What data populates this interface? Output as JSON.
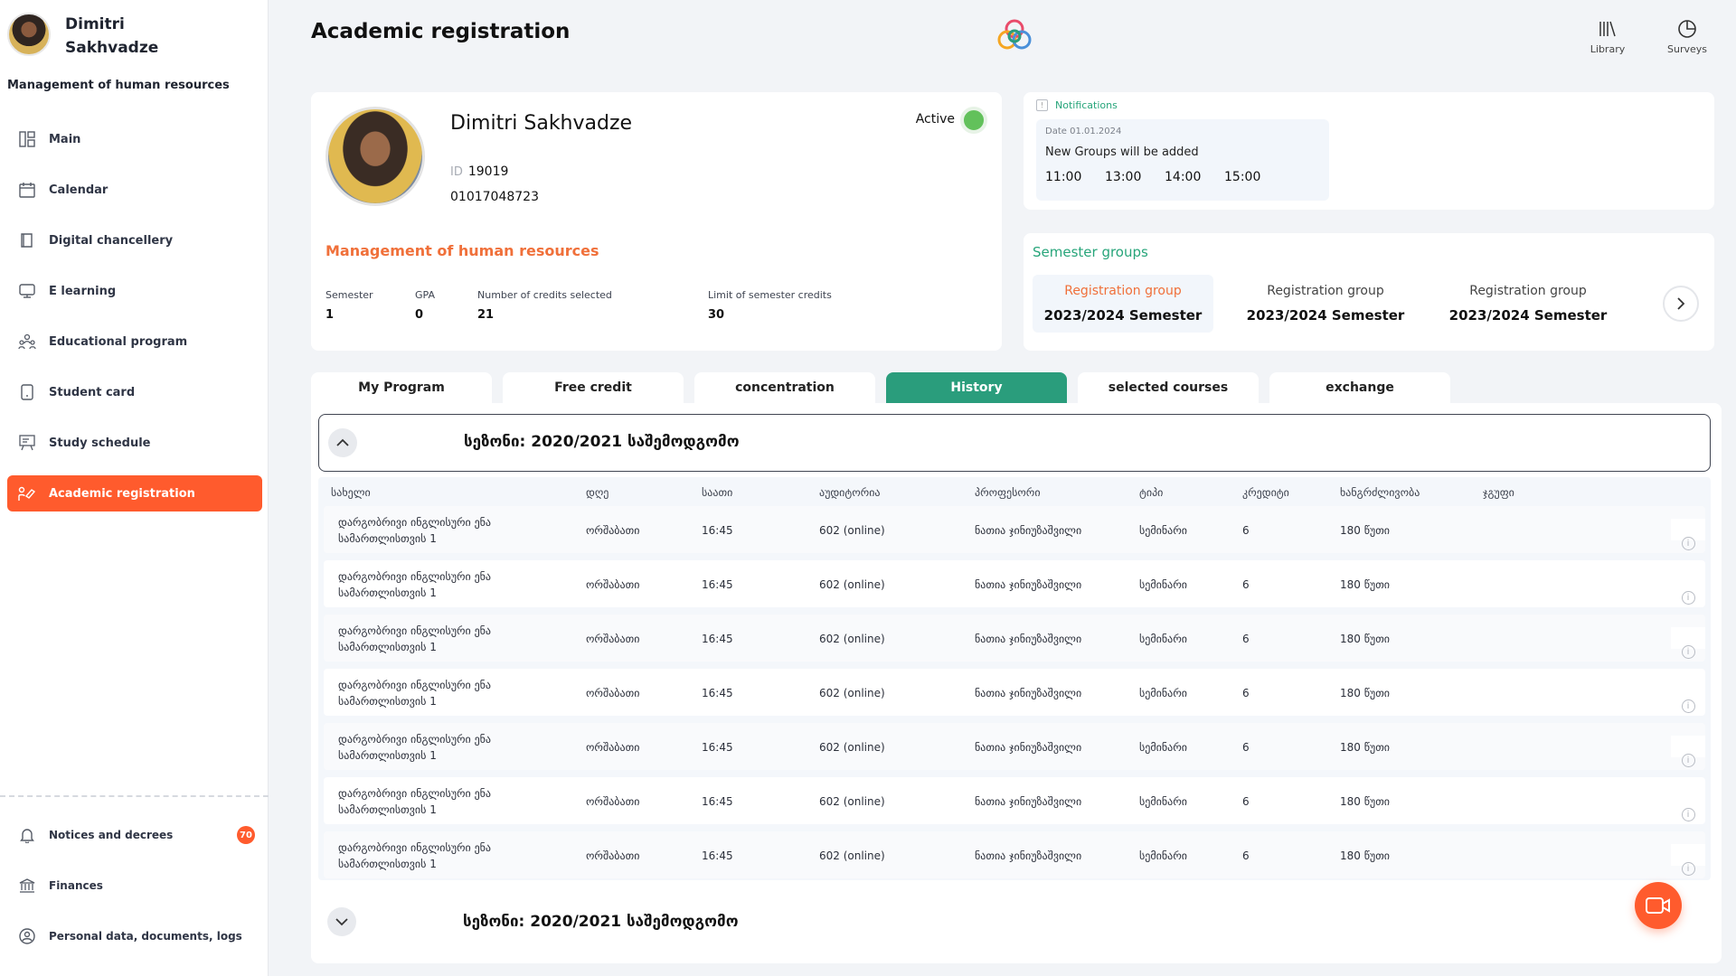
{
  "user": {
    "name": "Dimitri Sakhvadze",
    "role": "Management of human resources"
  },
  "nav": {
    "items": [
      {
        "label": "Main",
        "icon": "grid-icon"
      },
      {
        "label": "Calendar",
        "icon": "calendar-icon"
      },
      {
        "label": "Digital chancellery",
        "icon": "book-icon"
      },
      {
        "label": "E learning",
        "icon": "monitor-icon"
      },
      {
        "label": "Educational program",
        "icon": "people-icon"
      },
      {
        "label": "Student card",
        "icon": "card-icon"
      },
      {
        "label": "Study schedule",
        "icon": "board-icon"
      },
      {
        "label": "Academic registration",
        "icon": "registration-icon",
        "active": true
      }
    ],
    "bottom": [
      {
        "label": "Notices and decrees",
        "icon": "bell-icon",
        "badge": "70"
      },
      {
        "label": "Finances",
        "icon": "bank-icon"
      },
      {
        "label": "Personal data, documents, logs",
        "icon": "person-icon"
      }
    ]
  },
  "header": {
    "title": "Academic registration",
    "library": "Library",
    "surveys": "Surveys"
  },
  "profile": {
    "name": "Dimitri Sakhvadze",
    "id_label": "ID",
    "id": "19019",
    "personal_number": "01017048723",
    "status": "Active",
    "status_color": "#62c15b",
    "program": "Management of human resources",
    "stats": [
      {
        "label": "Semester",
        "value": "1"
      },
      {
        "label": "GPA",
        "value": "0"
      },
      {
        "label": "Number of credits selected",
        "value": "21"
      },
      {
        "label": "Limit of semester credits",
        "value": "30"
      }
    ]
  },
  "notifications": {
    "title": "Notifications",
    "date": "Date 01.01.2024",
    "text": "New Groups will be added",
    "times": [
      "11:00",
      "13:00",
      "14:00",
      "15:00"
    ]
  },
  "semester_groups": {
    "title": "Semester groups",
    "groups": [
      {
        "label": "Registration group",
        "semester": "2023/2024 Semester",
        "active": true
      },
      {
        "label": "Registration group",
        "semester": "2023/2024 Semester"
      },
      {
        "label": "Registration group",
        "semester": "2023/2024 Semester"
      }
    ]
  },
  "tabs": [
    "My Program",
    "Free credit",
    "concentration",
    "History",
    "selected courses",
    "exchange"
  ],
  "active_tab": "History",
  "history": {
    "season_1": "სეზონი: 2020/2021 საშემოდგომო",
    "season_2": "სეზონი: 2020/2021 საშემოდგომო",
    "columns": [
      "სახელი",
      "დღე",
      "საათი",
      "აუდიტორია",
      "პროფესორი",
      "ტიპი",
      "კრედიტი",
      "ხანგრძლივობა",
      "ჯგუფი"
    ],
    "rows": [
      {
        "name": "დარგობრივი ინგლისური ენა სამართლისთვის 1",
        "day": "ორშაბათი",
        "time": "16:45",
        "room": "602 (online)",
        "professor": "ნათია ჯინიუზაშვილი",
        "type": "სემინარი",
        "credits": "6",
        "duration": "180 წუთი",
        "group": ""
      },
      {
        "name": "დარგობრივი ინგლისური ენა სამართლისთვის 1",
        "day": "ორშაბათი",
        "time": "16:45",
        "room": "602 (online)",
        "professor": "ნათია ჯინიუზაშვილი",
        "type": "სემინარი",
        "credits": "6",
        "duration": "180 წუთი",
        "group": ""
      },
      {
        "name": "დარგობრივი ინგლისური ენა სამართლისთვის 1",
        "day": "ორშაბათი",
        "time": "16:45",
        "room": "602 (online)",
        "professor": "ნათია ჯინიუზაშვილი",
        "type": "სემინარი",
        "credits": "6",
        "duration": "180 წუთი",
        "group": ""
      },
      {
        "name": "დარგობრივი ინგლისური ენა სამართლისთვის 1",
        "day": "ორშაბათი",
        "time": "16:45",
        "room": "602 (online)",
        "professor": "ნათია ჯინიუზაშვილი",
        "type": "სემინარი",
        "credits": "6",
        "duration": "180 წუთი",
        "group": ""
      },
      {
        "name": "დარგობრივი ინგლისური ენა სამართლისთვის 1",
        "day": "ორშაბათი",
        "time": "16:45",
        "room": "602 (online)",
        "professor": "ნათია ჯინიუზაშვილი",
        "type": "სემინარი",
        "credits": "6",
        "duration": "180 წუთი",
        "group": ""
      },
      {
        "name": "დარგობრივი ინგლისური ენა სამართლისთვის 1",
        "day": "ორშაბათი",
        "time": "16:45",
        "room": "602 (online)",
        "professor": "ნათია ჯინიუზაშვილი",
        "type": "სემინარი",
        "credits": "6",
        "duration": "180 წუთი",
        "group": ""
      },
      {
        "name": "დარგობრივი ინგლისური ენა სამართლისთვის 1",
        "day": "ორშაბათი",
        "time": "16:45",
        "room": "602 (online)",
        "professor": "ნათია ჯინიუზაშვილი",
        "type": "სემინარი",
        "credits": "6",
        "duration": "180 წუთი",
        "group": ""
      }
    ]
  },
  "colors": {
    "accent": "#ff5b2d",
    "green": "#2a9d7c",
    "program": "#f0703a"
  }
}
